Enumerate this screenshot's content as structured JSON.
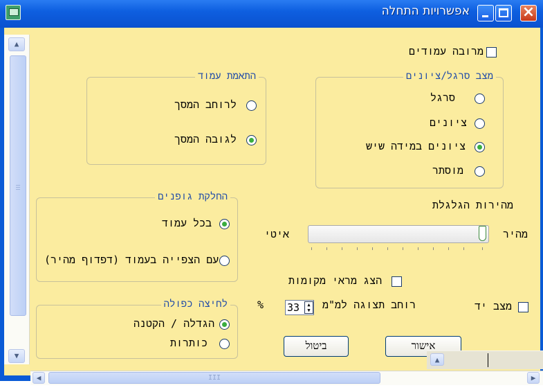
{
  "window": {
    "title": "אפשרויות התחלה"
  },
  "top_checkbox": {
    "label": "מרובה עמודים",
    "checked": false
  },
  "view_mode_group": {
    "title": "מצב סרגל/ציונים",
    "options": [
      {
        "label": "סרגל",
        "selected": false
      },
      {
        "label": "ציונים",
        "selected": false
      },
      {
        "label": "ציונים במידה שיש",
        "selected": true
      },
      {
        "label": "מוסתר",
        "selected": false
      }
    ]
  },
  "column_fit_group": {
    "title": "התאמת עמוד",
    "options": [
      {
        "label": "לרוחב המסך",
        "selected": false
      },
      {
        "label": "לגובה המסך",
        "selected": true
      }
    ]
  },
  "font_split_group": {
    "title": "החלקת גופנים",
    "options": [
      {
        "label": "בכל עמוד",
        "selected": true
      },
      {
        "label": "עם הצפייה בעמוד (דפדוף מהיר)",
        "selected": false
      }
    ]
  },
  "scroll_speed": {
    "title": "מהירות הגלגלת",
    "fast_label": "מהיר",
    "slow_label": "איטי",
    "value": 1.0
  },
  "show_refs_checkbox": {
    "label": "הצג מראי מקומות",
    "checked": false
  },
  "double_click_group": {
    "title": "לחיצה כפולה",
    "options": [
      {
        "label": "הגדלה / הקטנה",
        "selected": true
      },
      {
        "label": "כותרות",
        "selected": false
      }
    ]
  },
  "display_width": {
    "label": "רוחב תצוגה למ\"מ",
    "value": "33",
    "unit": "%"
  },
  "hand_mode_checkbox": {
    "label": "מצב יד",
    "checked": false
  },
  "buttons": {
    "ok": "אישור",
    "cancel": "ביטול"
  },
  "hscroll": {
    "grip": "III"
  }
}
